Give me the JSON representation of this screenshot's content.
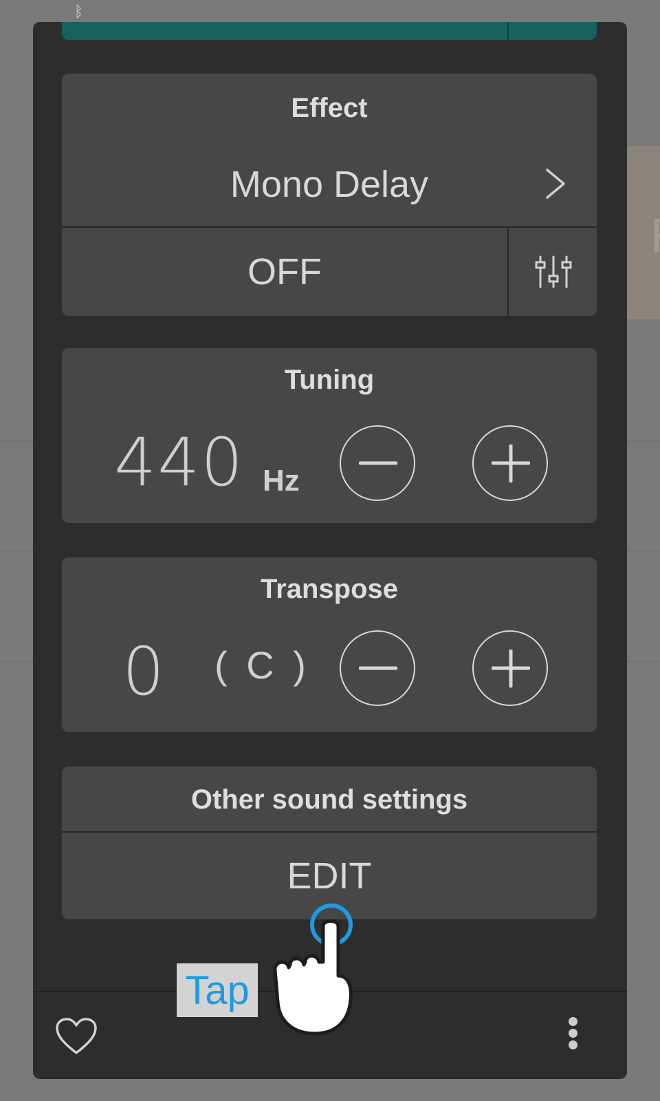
{
  "background": {
    "bluetooth_icon": "bluetooth-icon",
    "partial_letter": "F"
  },
  "colors": {
    "panel": "#2d2d2d",
    "card": "#474747",
    "accent_teal": "#17615f",
    "tap_blue": "#1e9be0"
  },
  "effect": {
    "title": "Effect",
    "name": "Mono Delay",
    "toggle_label": "OFF",
    "settings_icon": "sliders-icon",
    "chevron_icon": "chevron-right-icon"
  },
  "tuning": {
    "title": "Tuning",
    "value": "440",
    "unit": "Hz",
    "decrease_icon": "minus-icon",
    "increase_icon": "plus-icon"
  },
  "transpose": {
    "title": "Transpose",
    "value": "0",
    "key": "( C )",
    "decrease_icon": "minus-icon",
    "increase_icon": "plus-icon"
  },
  "other_sound_settings": {
    "title": "Other sound settings",
    "edit_label": "EDIT"
  },
  "bottom_bar": {
    "favorite_icon": "heart-icon",
    "more_icon": "more-vertical-icon"
  },
  "overlay": {
    "tap_label": "Tap",
    "hand_icon": "tap-hand-icon"
  }
}
